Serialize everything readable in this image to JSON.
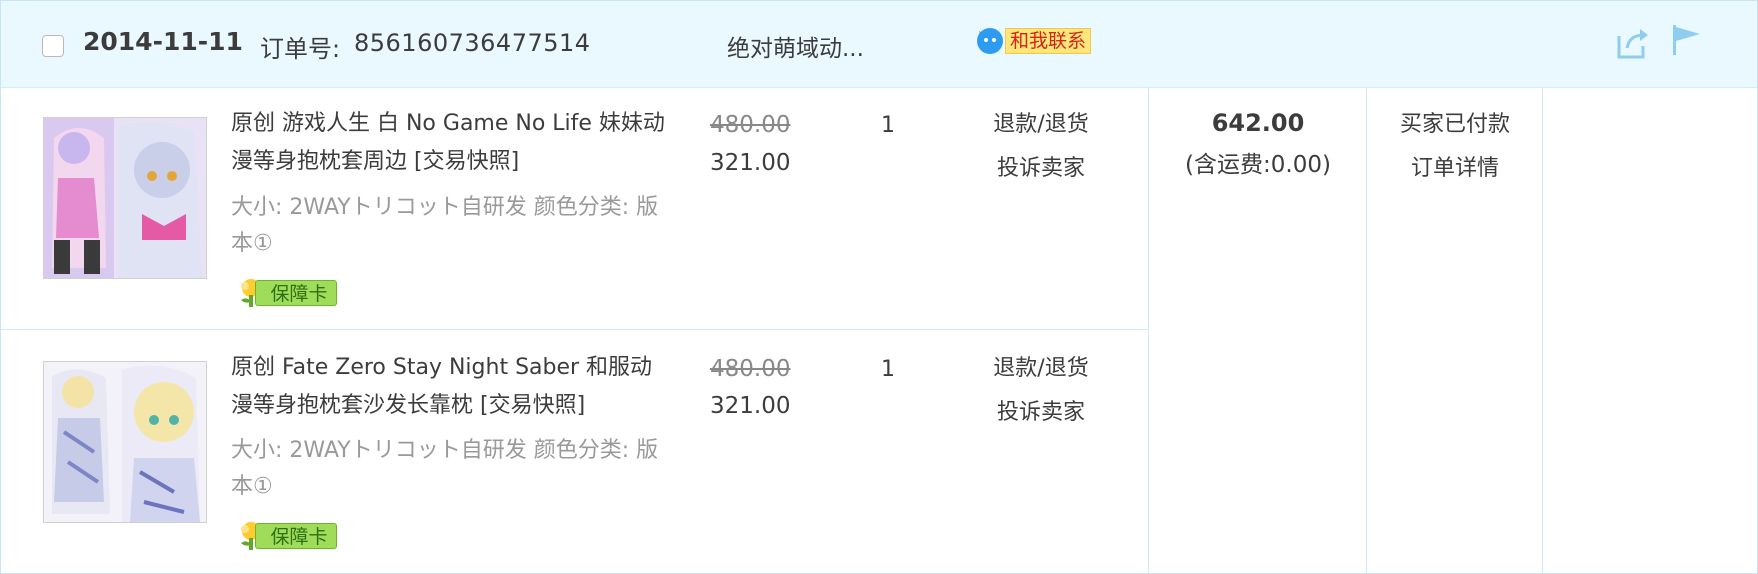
{
  "header": {
    "date": "2014-11-11",
    "order_label": "订单号:",
    "order_no": "856160736477514",
    "shop": "绝对萌域动...",
    "contact": "和我联系"
  },
  "items": [
    {
      "title": "原创 游戏人生 白 No Game No Life 妹妹动漫等身抱枕套周边 [交易快照]",
      "sku": "大小: 2WAYトリコット自研发 颜色分类: 版本①",
      "badge": "保障卡",
      "original_price": "480.00",
      "price": "321.00",
      "qty": "1",
      "actions": [
        "退款/退货",
        "投诉卖家"
      ]
    },
    {
      "title": "原创 Fate Zero Stay Night Saber 和服动漫等身抱枕套沙发长靠枕 [交易快照]",
      "sku": "大小: 2WAYトリコット自研发 颜色分类: 版本①",
      "badge": "保障卡",
      "original_price": "480.00",
      "price": "321.00",
      "qty": "1",
      "actions": [
        "退款/退货",
        "投诉卖家"
      ]
    }
  ],
  "total": {
    "amount": "642.00",
    "shipping": "(含运费:0.00)"
  },
  "status": {
    "state": "买家已付款",
    "detail_link": "订单详情"
  },
  "icons": {
    "checkbox": "checkbox-icon",
    "chat": "chat-bubble-icon",
    "share": "share-icon",
    "flag": "flag-icon",
    "badge": "flower-icon"
  },
  "colors": {
    "header_bg": "#eaf8ff",
    "border": "#d3ebf6",
    "contact_bg": "#ffe67a",
    "contact_text": "#d1261a",
    "icon_blue": "#8fcdf0",
    "badge_green": "#9fdc5a"
  }
}
